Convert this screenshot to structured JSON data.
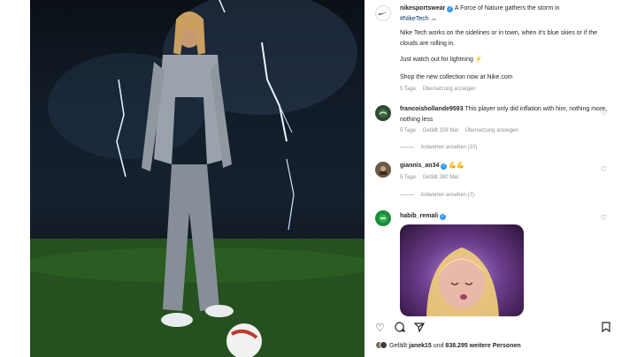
{
  "post": {
    "author": "nikesportswear",
    "caption_line1": "A Force of Nature gathers the storm in",
    "hashtag": "#NikeTech",
    "paragraph1": "Nike Tech works on the sidelines or in town, when it's blue skies or if the clouds are rolling in.",
    "paragraph2": "Just watch out for lightning",
    "paragraph3": "Shop the new collection now at Nike.com",
    "age": "5 Tage",
    "translate": "Übersetzung anzeigen"
  },
  "comments": [
    {
      "user": "francoishollande9593",
      "text": "This player only did inflation with him, nothing more, nothing less",
      "age": "5 Tage",
      "likes": "Gefällt 159 Mal",
      "translate": "Übersetzung anzeigen",
      "replies": "Antworten ansehen (10)"
    },
    {
      "user": "giannis_an34",
      "text": "",
      "age": "5 Tage",
      "likes": "Gefällt 280 Mal",
      "replies": "Antworten ansehen (7)"
    },
    {
      "user": "habib_remali"
    }
  ],
  "likes_line": {
    "prefix": "Gefällt",
    "user": "janek15",
    "middle": "und",
    "count": "838.295 weitere Personen"
  },
  "icons": {
    "brand": "nike-swoosh-icon",
    "heart": "heart-icon",
    "comment": "comment-icon",
    "share": "share-icon",
    "save": "bookmark-icon",
    "next": "chevron-right-icon"
  },
  "colors": {
    "link": "#00376b",
    "verified": "#3897f0",
    "meta": "#8e8e8e"
  }
}
